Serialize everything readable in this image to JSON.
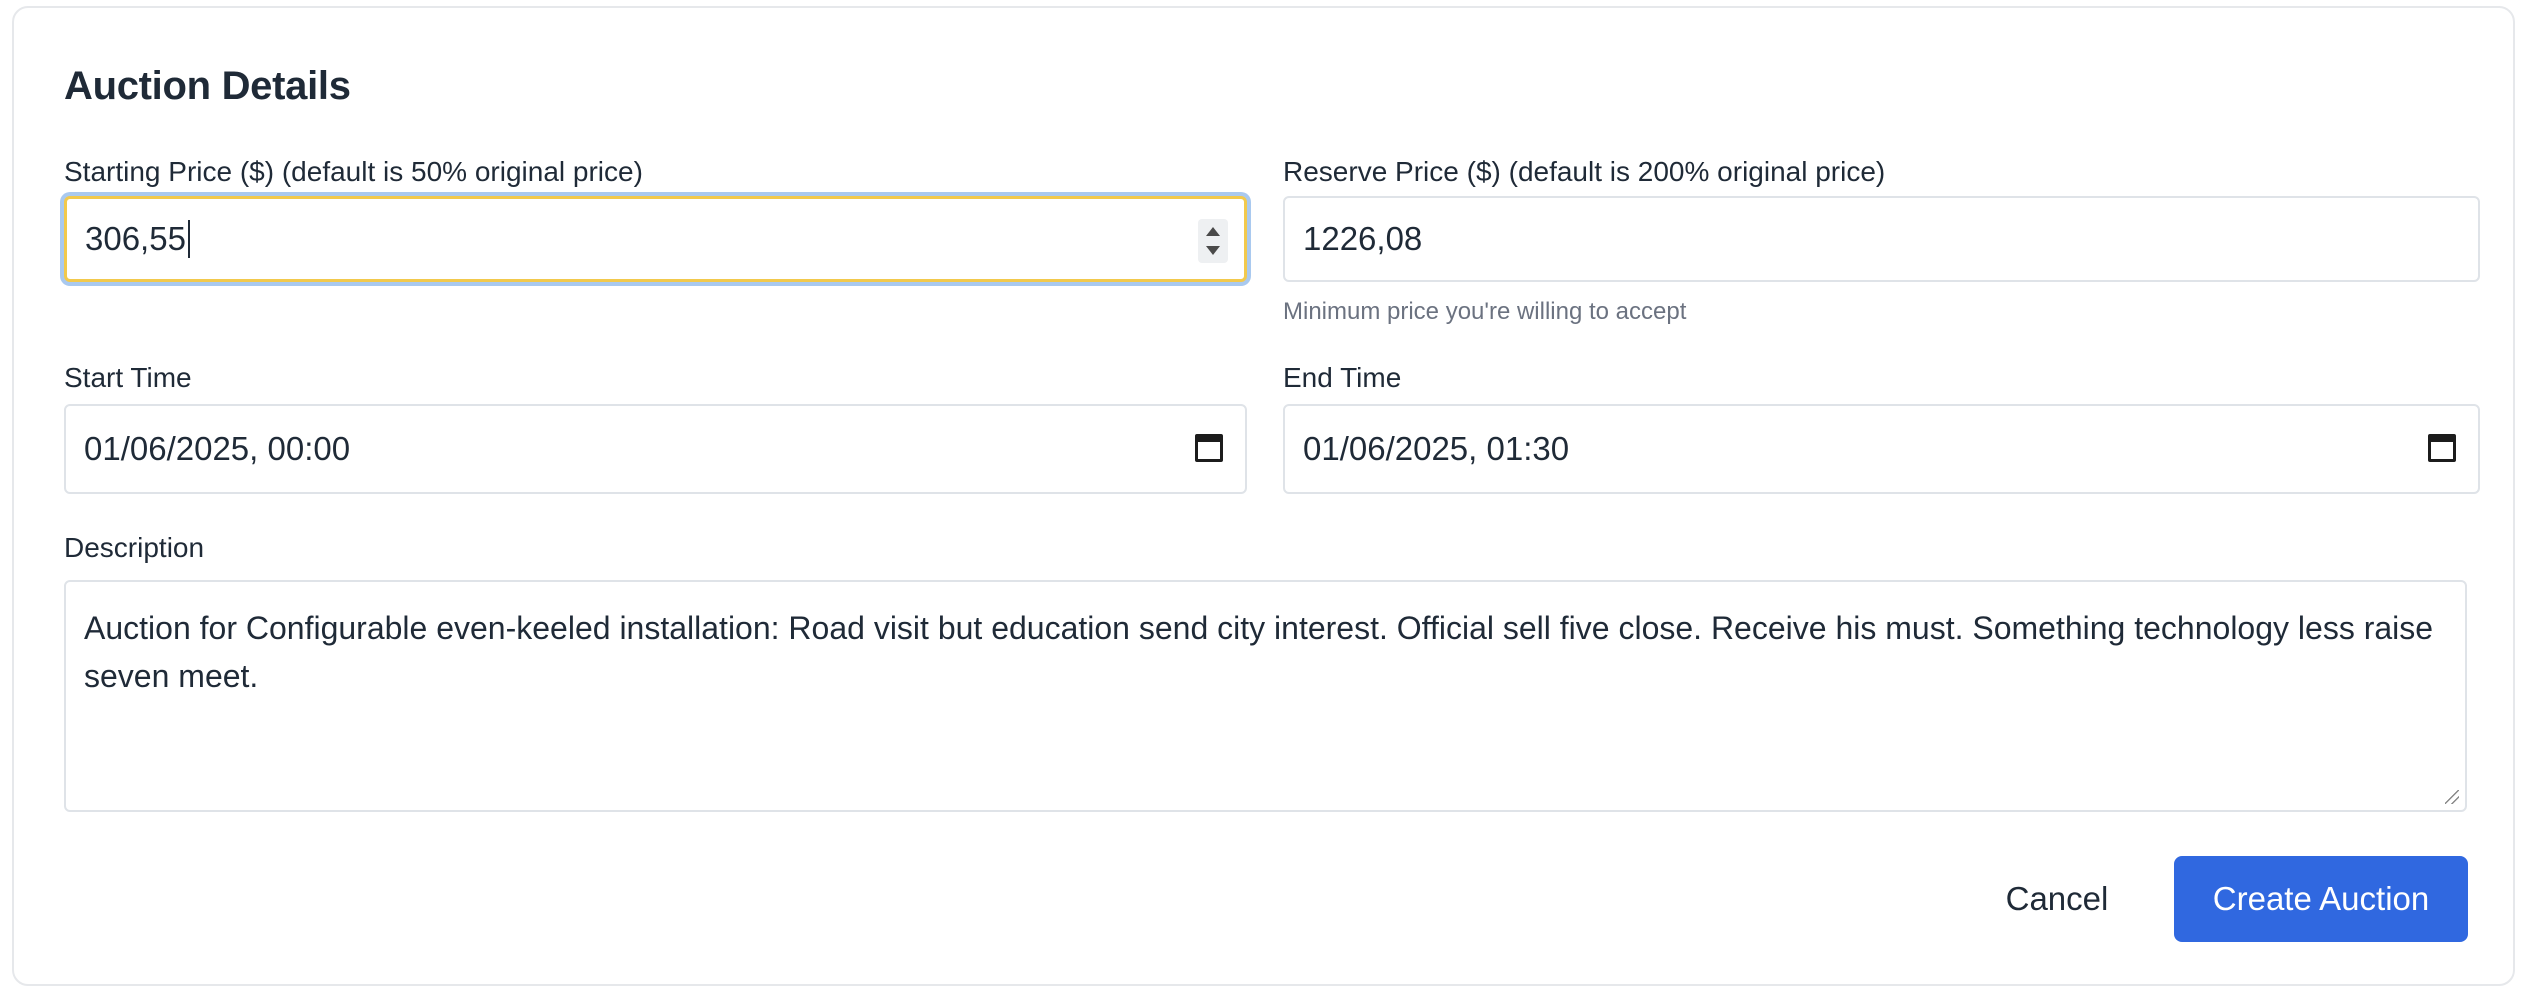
{
  "section": {
    "title": "Auction Details"
  },
  "starting_price": {
    "label": "Starting Price ($) (default is 50% original price)",
    "value": "306,55"
  },
  "reserve_price": {
    "label": "Reserve Price ($) (default is 200% original price)",
    "value": "1226,08",
    "helper": "Minimum price you're willing to accept"
  },
  "start_time": {
    "label": "Start Time",
    "value": "01/06/2025, 00:00"
  },
  "end_time": {
    "label": "End Time",
    "value": "01/06/2025, 01:30"
  },
  "description": {
    "label": "Description",
    "value": "Auction for Configurable even-keeled installation: Road visit but education send city interest. Official sell five close. Receive his must. Something technology less raise seven meet."
  },
  "actions": {
    "cancel_label": "Cancel",
    "create_label": "Create Auction"
  },
  "colors": {
    "primary": "#3068e0",
    "focus_ring": "#a9c9ef",
    "focus_border": "#f2c94c",
    "text": "#1f2a37",
    "muted": "#6b7280"
  },
  "icons": {
    "stepper": "number-stepper-icon",
    "calendar": "calendar-icon"
  }
}
